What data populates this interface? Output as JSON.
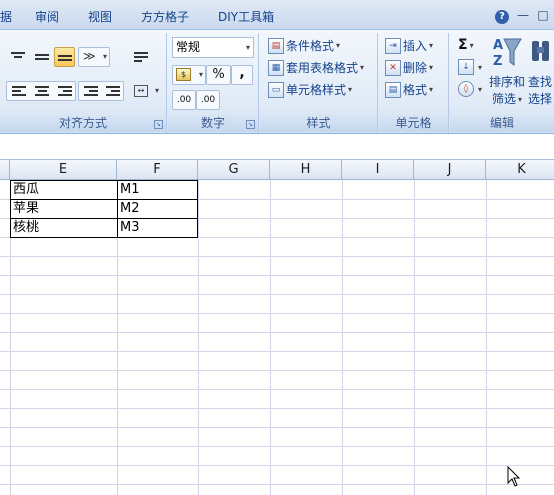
{
  "tabs": [
    {
      "label": "据"
    },
    {
      "label": "审阅"
    },
    {
      "label": "视图"
    },
    {
      "label": "方方格子"
    },
    {
      "label": "DIY工具箱"
    }
  ],
  "window": {
    "help": "?",
    "minimize": "—",
    "restore": "□"
  },
  "ribbon": {
    "alignment": {
      "label": "对齐方式"
    },
    "number": {
      "label": "数字",
      "format_value": "常规",
      "percent": "%",
      "comma": ",",
      "inc_decimal": ".00",
      "dec_decimal": ".00"
    },
    "styles": {
      "label": "样式",
      "items": [
        "条件格式",
        "套用表格格式",
        "单元格样式"
      ]
    },
    "cells": {
      "label": "单元格",
      "items": [
        "插入",
        "删除",
        "格式"
      ]
    },
    "editing": {
      "label": "编辑",
      "sum": "Σ",
      "sort_line1": "排序和",
      "sort_line2": "筛选",
      "find_line1": "查找",
      "find_line2": "选择"
    }
  },
  "columns": [
    "E",
    "F",
    "G",
    "H",
    "I",
    "J",
    "K"
  ],
  "rows": [
    {
      "e": "西瓜",
      "f": "M1"
    },
    {
      "e": "苹果",
      "f": "M2"
    },
    {
      "e": "核桃",
      "f": "M3"
    }
  ]
}
